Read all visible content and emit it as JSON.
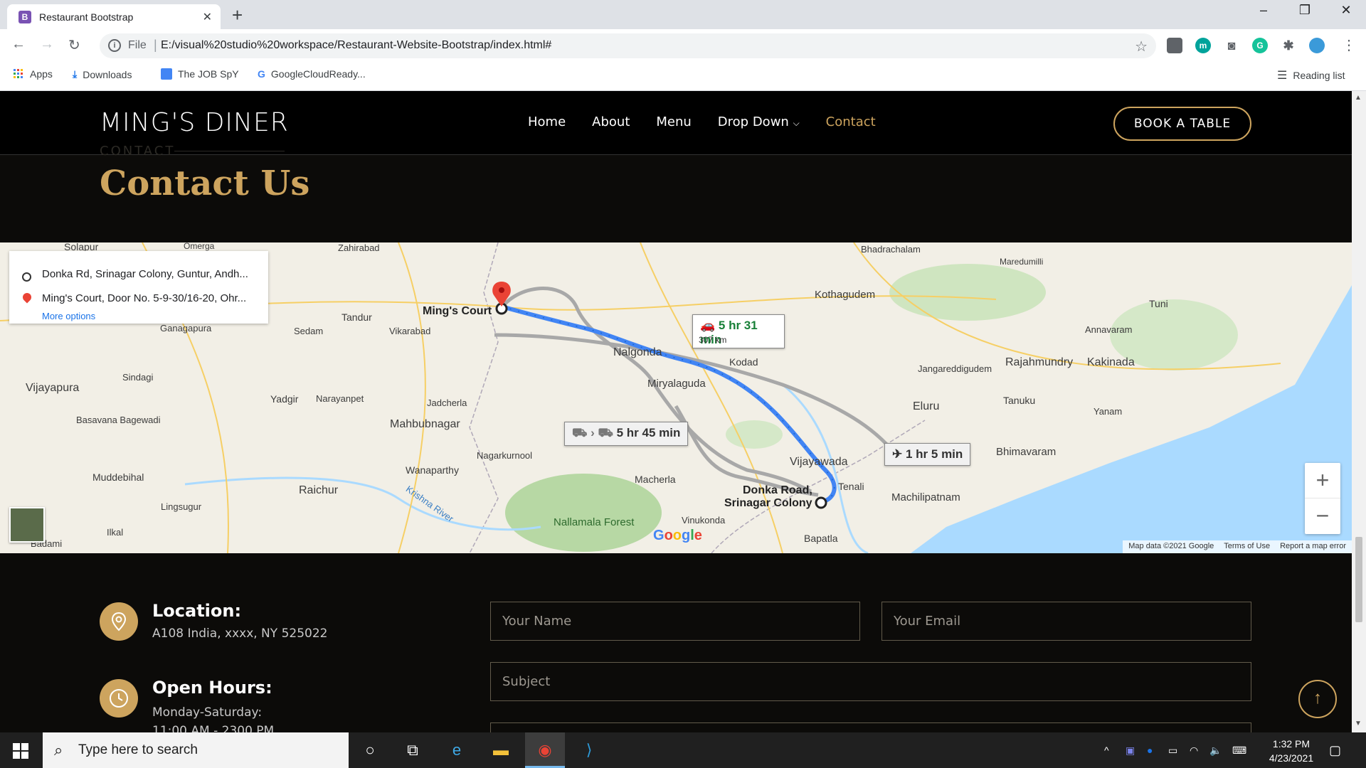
{
  "browser": {
    "tab_title": "Restaurant Bootstrap",
    "tab_favicon": "B",
    "new_tab": "+",
    "address_scheme": "File",
    "address_url": "E:/visual%20studio%20workspace/Restaurant-Website-Bootstrap/index.html#",
    "bookmarks": [
      "Apps",
      "Downloads",
      "The JOB SpY",
      "GoogleCloudReady..."
    ],
    "reading_list": "Reading list",
    "window_controls": [
      "–",
      "❐",
      "✕"
    ]
  },
  "site": {
    "logo": "MING'S DINER",
    "nav": [
      "Home",
      "About",
      "Menu",
      "Drop Down",
      "Contact"
    ],
    "active_nav": "Contact",
    "book_button": "BOOK A TABLE",
    "section_label": "CONTACT",
    "section_title": "Contact Us",
    "accent_color": "#cda45e"
  },
  "map": {
    "origin": "Donka Rd, Srinagar Colony, Guntur, Andh...",
    "destination": "Ming's Court, Door No. 5-9-30/16-20, Ohr...",
    "more_options": "More options",
    "car_time": "5 hr 31 min",
    "car_distance": "307 km",
    "transit_time": "5 hr 45 min",
    "flight_time": "1 hr 5 min",
    "dest_label": "Ming's Court",
    "origin_label_1": "Donka Road,",
    "origin_label_2": "Srinagar Colony",
    "places": [
      "Solapur",
      "Zahirabad",
      "Tandur",
      "Vikarabad",
      "Sedam",
      "Vijayapura",
      "Sindagi",
      "Yadgir",
      "Narayanpet",
      "Jadcherla",
      "Mahbubnagar",
      "Nalgonda",
      "Miryalaguda",
      "Kodad",
      "Kothagudem",
      "Bhadrachalam",
      "Maredumilli",
      "Rajahmundry",
      "Kakinada",
      "Jangareddigudem",
      "Eluru",
      "Tanuku",
      "Vijayawada",
      "Tenali",
      "Machilipatnam",
      "Bhimavaram",
      "Nagarkurnool",
      "Wanaparthy",
      "Raichur",
      "Macherla",
      "Vinukonda",
      "Bapatla",
      "Nallamala Forest",
      "Muddebihal",
      "Basavana Bagewadi",
      "Lingsugur",
      "Ilkal",
      "Badami",
      "Ganagapura",
      "Tuni",
      "Annavaram",
      "Yanam",
      "Krishna River",
      "Omerga"
    ],
    "zoom_in": "+",
    "zoom_out": "−",
    "google": "Google",
    "footer": [
      "Map data ©2021 Google",
      "Terms of Use",
      "Report a map error"
    ]
  },
  "contact": {
    "location_title": "Location:",
    "location_text": "A108 India, xxxx, NY 525022",
    "hours_title": "Open Hours:",
    "hours_text_1": "Monday-Saturday:",
    "hours_text_2": "11:00 AM - 2300 PM",
    "name_placeholder": "Your Name",
    "email_placeholder": "Your Email",
    "subject_placeholder": "Subject"
  },
  "taskbar": {
    "search_placeholder": "Type here to search",
    "time": "1:32 PM",
    "date": "4/23/2021"
  }
}
